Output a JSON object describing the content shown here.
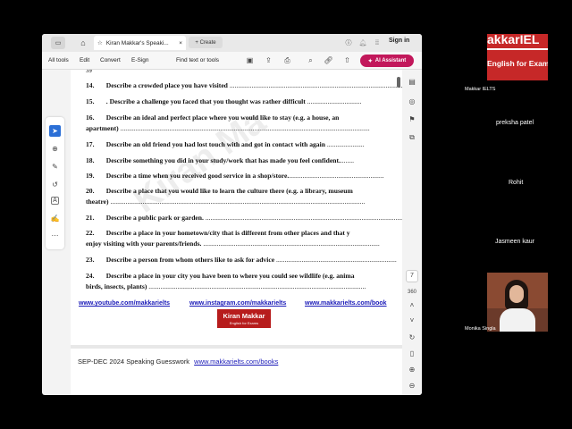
{
  "browser": {
    "tab_title": "Kiran Makkar's Speaki...",
    "new_tab_label": "+ Create",
    "sign_in_label": "Sign in"
  },
  "toolbar": {
    "menu": [
      "All tools",
      "Edit",
      "Convert",
      "E-Sign"
    ],
    "find_label": "Find text or tools",
    "ai_label": "AI Assistant"
  },
  "document": {
    "partial_top": "39",
    "questions": [
      {
        "num": "14.",
        "text": "Describe a crowded place you have visited",
        "dots": " ................................................................................................................"
      },
      {
        "num": "15.",
        "text": ". Describe a challenge you faced that you thought was rather difficult",
        "dots": " ................................"
      },
      {
        "num": "16.",
        "text": "Describe an ideal and perfect place where you would like to stay (e.g. a house, an",
        "cont": "apartment)",
        "dots": " ..................................................................................................................................................."
      },
      {
        "num": "17.",
        "text": "Describe an old friend you had lost touch with and got in contact with again",
        "dots": " ......................"
      },
      {
        "num": "18.",
        "text": "Describe something you did in your study/work that has made you feel confident.",
        "dots": "........"
      },
      {
        "num": "19.",
        "text": "Describe a time when you received good service in a shop/store.",
        "dots": "........................................................"
      },
      {
        "num": "20.",
        "text": "Describe a place that you would like to learn the culture there (e.g. a library, museum",
        "cont": "theatre)",
        "dots": " ......................................................................................................................................................"
      },
      {
        "num": "21.",
        "text": "Describe a public park or garden.",
        "dots": " ........................................................................................................................"
      },
      {
        "num": "22.",
        "text": "Describe a place in your hometown/city that is different from other places and that y",
        "cont": "enjoy visiting with your parents/friends.",
        "dots": " ........................................................................................................"
      },
      {
        "num": "23.",
        "text": "Describe a person from whom others like to ask for advice",
        "dots": " ......................................................................."
      },
      {
        "num": "24.",
        "text": "Describe a place in your city you have been to where you could see wildlife (e.g. anima",
        "cont": "birds, insects, plants)",
        "dots": " ................................................................................................................................"
      }
    ],
    "links": [
      "www.youtube.com/makkarielts",
      "www.instagram.com/makkarielts",
      "www.makkarielts.com/book"
    ],
    "logo_title": "Kiran Makkar",
    "logo_sub": "English for Exams",
    "footer_text": "SEP-DEC 2024 Speaking Guesswork",
    "footer_link": "www.makkarielts.com/books",
    "watermark": "Kiran Ma"
  },
  "right_panel": {
    "page_number": "7",
    "page_total": "360"
  },
  "participants": [
    {
      "name": "Makkar IELTS",
      "banner_top": "akkarIEL",
      "banner_bottom": "English for Exam"
    },
    {
      "name": "preksha patel"
    },
    {
      "name": "Rohit"
    },
    {
      "name": "Jasmeen kaur"
    },
    {
      "name": "Monika Singla"
    }
  ],
  "colors": {
    "ai_button": "#c2185b",
    "link": "#1a1ab8",
    "logo_bg": "#b71c1c"
  }
}
